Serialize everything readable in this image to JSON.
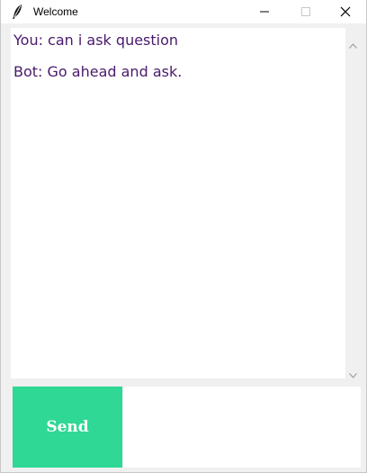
{
  "window": {
    "title": "Welcome",
    "app_icon": "feather-icon"
  },
  "controls": {
    "minimize_icon": "minimize-icon",
    "maximize_icon": "maximize-icon",
    "close_icon": "close-icon"
  },
  "chat": {
    "messages": [
      {
        "text": "You: can i ask question"
      },
      {
        "text": "Bot: Go ahead and ask."
      }
    ],
    "text_color": "#4a1a6b"
  },
  "scrollbar": {
    "up_icon": "scroll-up-arrow-icon",
    "down_icon": "scroll-down-arrow-icon"
  },
  "input": {
    "send_label": "Send",
    "send_color": "#30d895",
    "entry_value": ""
  }
}
